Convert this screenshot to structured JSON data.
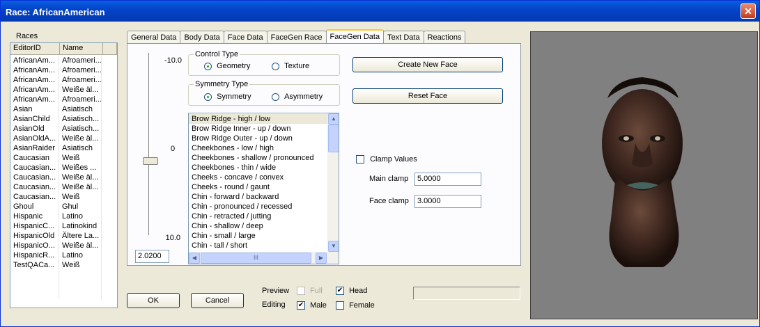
{
  "window": {
    "title": "Race: AfricanAmerican",
    "close_glyph": "✕"
  },
  "races": {
    "label": "Races",
    "columns": [
      "EditorID",
      "Name"
    ],
    "rows": [
      [
        "AfricanAm...",
        "Afroameri..."
      ],
      [
        "AfricanAm...",
        "Afroameri..."
      ],
      [
        "AfricanAm...",
        "Afroameri..."
      ],
      [
        "AfricanAm...",
        "Weiße äl..."
      ],
      [
        "AfricanAm...",
        "Afroameri..."
      ],
      [
        "Asian",
        "Asiatisch"
      ],
      [
        "AsianChild",
        "Asiatisch..."
      ],
      [
        "AsianOld",
        "Asiatisch..."
      ],
      [
        "AsianOldA...",
        "Weiße äl..."
      ],
      [
        "AsianRaider",
        "Asiatisch"
      ],
      [
        "Caucasian",
        "Weiß"
      ],
      [
        "Caucasian...",
        "Weißes ..."
      ],
      [
        "Caucasian...",
        "Weiße äl..."
      ],
      [
        "Caucasian...",
        "Weiße äl..."
      ],
      [
        "Caucasian...",
        "Weiß"
      ],
      [
        "Ghoul",
        "Ghul"
      ],
      [
        "Hispanic",
        "Latino"
      ],
      [
        "HispanicC...",
        "Latinokind"
      ],
      [
        "HispanicOld",
        "Ältere La..."
      ],
      [
        "HispanicO...",
        "Weiße äl..."
      ],
      [
        "HispanicR...",
        "Latino"
      ],
      [
        "TestQACa...",
        "Weiß"
      ]
    ]
  },
  "tabs": [
    "General Data",
    "Body Data",
    "Face Data",
    "FaceGen Race",
    "FaceGen Data",
    "Text Data",
    "Reactions"
  ],
  "active_tab": "FaceGen Data",
  "slider": {
    "max_label": "-10.0",
    "mid_label": "0",
    "min_label": "10.0",
    "value": "2.0200",
    "level": 0.6
  },
  "control_type": {
    "title": "Control Type",
    "geometry": "Geometry",
    "texture": "Texture",
    "selected": "Geometry"
  },
  "symmetry_type": {
    "title": "Symmetry Type",
    "symmetry": "Symmetry",
    "asymmetry": "Asymmetry",
    "selected": "Symmetry"
  },
  "attributes": [
    "Brow Ridge - high / low",
    "Brow Ridge Inner - up / down",
    "Brow Ridge Outer - up / down",
    "Cheekbones - low / high",
    "Cheekbones - shallow / pronounced",
    "Cheekbones - thin / wide",
    "Cheeks - concave / convex",
    "Cheeks - round / gaunt",
    "Chin - forward / backward",
    "Chin - pronounced / recessed",
    "Chin - retracted / jutting",
    "Chin - shallow / deep",
    "Chin - small / large",
    "Chin - tall / short"
  ],
  "hscroll_grip": "III",
  "buttons": {
    "create_face": "Create New Face",
    "reset_face": "Reset Face",
    "ok": "OK",
    "cancel": "Cancel"
  },
  "clamp": {
    "clamp_values_label": "Clamp Values",
    "main_clamp_label": "Main clamp",
    "main_clamp_value": "5.0000",
    "face_clamp_label": "Face clamp",
    "face_clamp_value": "3.0000"
  },
  "preview_opts": {
    "preview_label": "Preview",
    "full_label": "Full",
    "head_label": "Head",
    "editing_label": "Editing",
    "male_label": "Male",
    "female_label": "Female"
  },
  "colors": {
    "title_bar": "#0a5fe0",
    "preview_bg": "#808080"
  }
}
